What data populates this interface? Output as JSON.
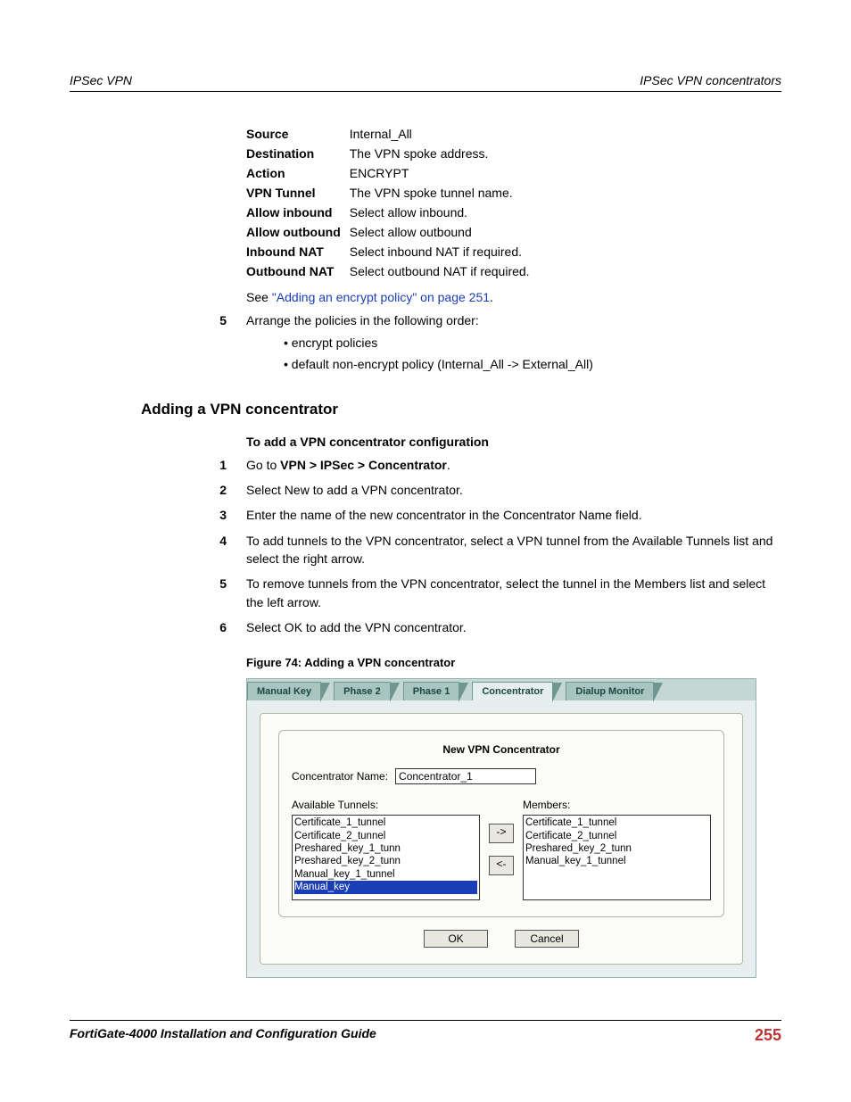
{
  "header": {
    "left": "IPSec VPN",
    "right": "IPSec VPN concentrators"
  },
  "fields": [
    {
      "label": "Source",
      "value": "Internal_All"
    },
    {
      "label": "Destination",
      "value": "The VPN spoke address."
    },
    {
      "label": "Action",
      "value": "ENCRYPT"
    },
    {
      "label": "VPN Tunnel",
      "value": "The VPN spoke tunnel name."
    },
    {
      "label": "Allow inbound",
      "value": "Select allow inbound."
    },
    {
      "label": "Allow outbound",
      "value": "Select allow outbound"
    },
    {
      "label": "Inbound NAT",
      "value": "Select inbound NAT if required."
    },
    {
      "label": "Outbound NAT",
      "value": "Select outbound NAT if required."
    }
  ],
  "see": {
    "prefix": "See ",
    "link": "\"Adding an encrypt policy\" on page 251",
    "suffix": "."
  },
  "step5": {
    "num": "5",
    "text": "Arrange the policies in the following order:",
    "bullets": [
      "encrypt policies",
      "default non-encrypt policy (Internal_All -> External_All)"
    ]
  },
  "section_heading": "Adding a VPN concentrator",
  "sub_heading": "To add a VPN concentrator configuration",
  "steps": [
    {
      "num": "1",
      "text_parts": [
        "Go to ",
        "VPN > IPSec > Concentrator",
        "."
      ]
    },
    {
      "num": "2",
      "text": "Select New to add a VPN concentrator."
    },
    {
      "num": "3",
      "text": "Enter the name of the new concentrator in the Concentrator Name field."
    },
    {
      "num": "4",
      "text": "To add tunnels to the VPN concentrator, select a VPN tunnel from the Available Tunnels list and select the right arrow."
    },
    {
      "num": "5",
      "text": "To remove tunnels from the VPN concentrator, select the tunnel in the Members list and select the left arrow."
    },
    {
      "num": "6",
      "text": "Select OK to add the VPN concentrator."
    }
  ],
  "figure_caption": "Figure 74: Adding a VPN concentrator",
  "screenshot": {
    "tabs": [
      "Manual Key",
      "Phase 2",
      "Phase 1",
      "Concentrator",
      "Dialup Monitor"
    ],
    "active_tab": "Concentrator",
    "form_title": "New VPN Concentrator",
    "name_label": "Concentrator Name:",
    "name_value": "Concentrator_1",
    "available_label": "Available Tunnels:",
    "available_items": [
      "Certificate_1_tunnel",
      "Certificate_2_tunnel",
      "Preshared_key_1_tunn",
      "Preshared_key_2_tunn",
      "Manual_key_1_tunnel",
      "Manual_key"
    ],
    "selected_item": "Manual_key",
    "members_label": "Members:",
    "members_items": [
      "Certificate_1_tunnel",
      "Certificate_2_tunnel",
      "Preshared_key_2_tunn",
      "Manual_key_1_tunnel"
    ],
    "arrow_right": "->",
    "arrow_left": "<-",
    "ok": "OK",
    "cancel": "Cancel"
  },
  "footer": {
    "guide": "FortiGate-4000 Installation and Configuration Guide",
    "pagenum": "255"
  }
}
